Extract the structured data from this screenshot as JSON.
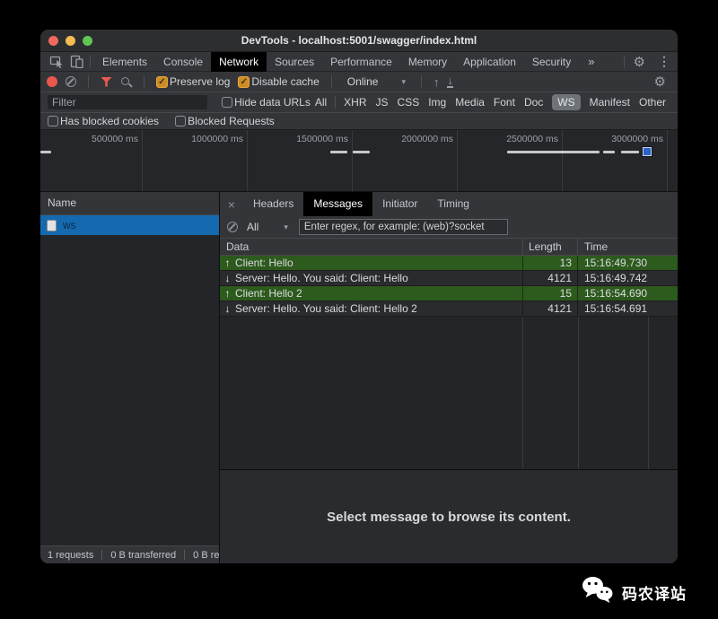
{
  "window": {
    "title": "DevTools - localhost:5001/swagger/index.html"
  },
  "tabbar": {
    "tabs": [
      "Elements",
      "Console",
      "Network",
      "Sources",
      "Performance",
      "Memory",
      "Application",
      "Security"
    ],
    "active": "Network",
    "more": "»"
  },
  "toolbar": {
    "preserve_log": "Preserve log",
    "disable_cache": "Disable cache",
    "throttling": "Online"
  },
  "filterbar": {
    "filter_placeholder": "Filter",
    "hide_data_urls": "Hide data URLs",
    "types": [
      "All",
      "XHR",
      "JS",
      "CSS",
      "Img",
      "Media",
      "Font",
      "Doc",
      "WS",
      "Manifest",
      "Other"
    ],
    "active_type": "WS"
  },
  "blockedbar": {
    "has_blocked_cookies": "Has blocked cookies",
    "blocked_requests": "Blocked Requests"
  },
  "timeline": {
    "ticks": [
      "500000 ms",
      "1000000 ms",
      "1500000 ms",
      "2000000 ms",
      "2500000 ms",
      "3000000 ms"
    ]
  },
  "requests": {
    "name_header": "Name",
    "rows": [
      {
        "name": "ws",
        "selected": true
      }
    ]
  },
  "details": {
    "close": "×",
    "tabs": [
      "Headers",
      "Messages",
      "Initiator",
      "Timing"
    ],
    "active": "Messages"
  },
  "messages": {
    "filter_all": "All",
    "regex_placeholder": "Enter regex, for example: (web)?socket",
    "columns": [
      "Data",
      "Length",
      "Time"
    ],
    "rows": [
      {
        "direction": "sent",
        "data": "Client: Hello",
        "length": "13",
        "time": "15:16:49.730"
      },
      {
        "direction": "received",
        "data": "Server: Hello. You said: Client: Hello",
        "length": "4121",
        "time": "15:16:49.742"
      },
      {
        "direction": "sent",
        "data": "Client: Hello 2",
        "length": "15",
        "time": "15:16:54.690"
      },
      {
        "direction": "received",
        "data": "Server: Hello. You said: Client: Hello 2",
        "length": "4121",
        "time": "15:16:54.691"
      }
    ],
    "empty_hint": "Select message to browse its content."
  },
  "statusbar": {
    "items": [
      "1 requests",
      "0 B transferred",
      "0 B re"
    ]
  },
  "watermark": {
    "text": "码农译站"
  },
  "colors": {
    "selected_row_blue": "#1469af",
    "sent_row_green": "#2d5a1d",
    "record_red": "#e9584c",
    "checkbox_orange": "#cf8c22",
    "timeline_marker_blue": "#2e62c8",
    "active_tab_bg": "#000000",
    "toolbar_bg": "#333539",
    "panel_bg": "#242528"
  }
}
